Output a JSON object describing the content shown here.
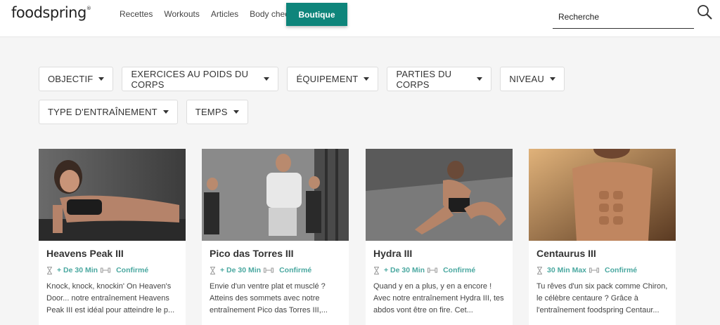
{
  "header": {
    "logo": "foodspring",
    "logo_mark": "®",
    "nav": [
      "Recettes",
      "Workouts",
      "Articles",
      "Body check"
    ],
    "shop_button": "Boutique",
    "search_placeholder": "Recherche"
  },
  "filters": {
    "row1": [
      "OBJECTIF",
      "EXERCICES AU POIDS DU CORPS",
      "ÉQUIPEMENT",
      "PARTIES DU CORPS",
      "NIVEAU"
    ],
    "row2": [
      "TYPE D'ENTRAÎNEMENT",
      "TEMPS"
    ]
  },
  "workouts": [
    {
      "title": "Heavens Peak III",
      "duration": "+ De 30 Min",
      "level": "Confirmé",
      "description": "Knock, knock, knockin' On Heaven's Door... notre entraînement Heavens Peak III est idéal pour atteindre le p..."
    },
    {
      "title": "Pico das Torres III",
      "duration": "+ De 30 Min",
      "level": "Confirmé",
      "description": "Envie d'un ventre plat et musclé ? Atteins des sommets avec notre entraînement Pico das Torres III,..."
    },
    {
      "title": "Hydra III",
      "duration": "+ De 30 Min",
      "level": "Confirmé",
      "description": "Quand y en a plus, y en a encore ! Avec notre entraînement Hydra III, tes abdos vont être on fire. Cet..."
    },
    {
      "title": "Centaurus III",
      "duration": "30 Min Max",
      "level": "Confirmé",
      "description": "Tu rêves d'un six pack comme Chiron, le célèbre centaure ? Grâce à l'entraînement foodspring Centaur..."
    }
  ],
  "colors": {
    "accent": "#0e857b",
    "meta": "#4aa8a0"
  }
}
